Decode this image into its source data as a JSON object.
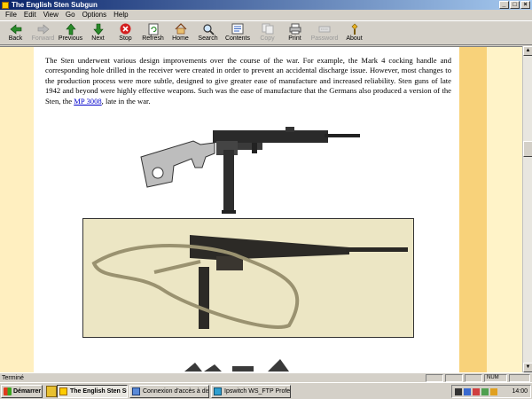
{
  "window": {
    "title": "The English Sten Subgun"
  },
  "menu": [
    "File",
    "Edit",
    "View",
    "Go",
    "Options",
    "Help"
  ],
  "toolbar": [
    {
      "label": "Back",
      "icon": "back-arrow-icon",
      "enabled": true
    },
    {
      "label": "Forward",
      "icon": "forward-arrow-icon",
      "enabled": false
    },
    {
      "label": "Previous",
      "icon": "previous-arrow-icon",
      "enabled": true
    },
    {
      "label": "Next",
      "icon": "next-arrow-icon",
      "enabled": true
    },
    {
      "label": "Stop",
      "icon": "stop-icon",
      "enabled": true
    },
    {
      "label": "Refresh",
      "icon": "refresh-icon",
      "enabled": true
    },
    {
      "label": "Home",
      "icon": "home-icon",
      "enabled": true
    },
    {
      "label": "Search",
      "icon": "search-icon",
      "enabled": true
    },
    {
      "label": "Contents",
      "icon": "contents-icon",
      "enabled": true
    },
    {
      "label": "Copy",
      "icon": "copy-icon",
      "enabled": false
    },
    {
      "label": "Print",
      "icon": "print-icon",
      "enabled": true
    },
    {
      "label": "Password",
      "icon": "password-icon",
      "enabled": false
    },
    {
      "label": "About",
      "icon": "about-icon",
      "enabled": true
    }
  ],
  "article": {
    "text_before_link": "The Sten underwent various design improvements over the course of the war. For example, the Mark 4 cocking handle and corresponding hole drilled in the receiver were created in order to prevent an accidental discharge issue. However, most changes to the production process were more subtle, designed to give greater ease of manufacture and increased reliability. Sten guns of late 1942 and beyond were highly effective weapons. Such was the ease of manufacture that the Germans also produced a version of the Sten, the ",
    "link_text": "MP 3008",
    "text_after_link": ", late in the war."
  },
  "status": {
    "text": "Terminé",
    "num": "NUM"
  },
  "taskbar": {
    "start_label": "Démarrer",
    "tasks": [
      {
        "label": "The English Sten Subg...",
        "active": true
      },
      {
        "label": "Connexion d'accès à dist...",
        "active": false
      },
      {
        "label": "Ipswitch WS_FTP Profes...",
        "active": false
      }
    ],
    "clock": "14:00"
  },
  "colors": {
    "page_bg": "#ffffff",
    "margin_bg": "#fff3c8",
    "accent_strip": "#f8d27a",
    "link": "#0000cc",
    "titlebar_start": "#0a246a"
  }
}
